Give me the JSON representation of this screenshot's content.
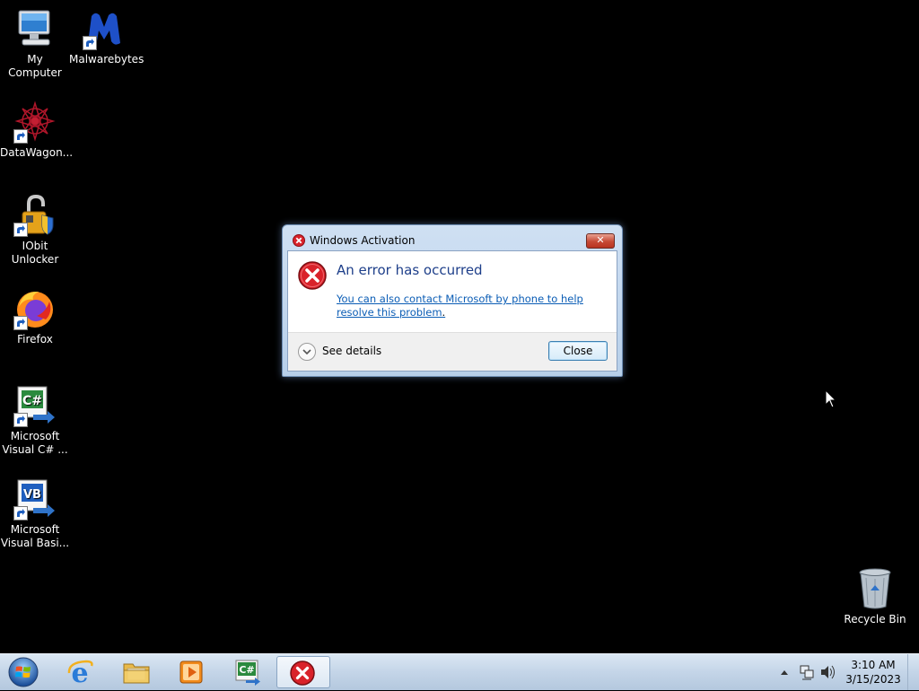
{
  "desktop": {
    "icons": [
      {
        "label": "My Computer",
        "icon": "computer-icon"
      },
      {
        "label": "Malwarebytes",
        "icon": "malwarebytes-icon"
      },
      {
        "label": "DataWagon...",
        "icon": "datawagon-icon"
      },
      {
        "label": "IObit Unlocker",
        "icon": "iobit-unlocker-icon"
      },
      {
        "label": "Firefox",
        "icon": "firefox-icon"
      },
      {
        "label": "Microsoft Visual C# ...",
        "icon": "visual-csharp-icon"
      },
      {
        "label": "Microsoft Visual Basi...",
        "icon": "visual-basic-icon"
      },
      {
        "label": "Recycle Bin",
        "icon": "recycle-bin-icon"
      }
    ]
  },
  "dialog": {
    "title": "Windows Activation",
    "close_glyph": "✕",
    "heading": "An error has occurred",
    "link_text": "You can also contact Microsoft by phone to help resolve this problem",
    "link_suffix": ".",
    "details_label": "See details",
    "close_button": "Close",
    "error_color": "#d9222a"
  },
  "taskbar": {
    "pinned": [
      "internet-explorer-icon",
      "file-explorer-icon",
      "media-player-icon",
      "visual-csharp-icon",
      "error-dialog-icon"
    ],
    "tray_icons": [
      "show-hidden-icons-arrow",
      "network-icon",
      "volume-icon"
    ],
    "time": "3:10 AM",
    "date": "3/15/2023"
  }
}
